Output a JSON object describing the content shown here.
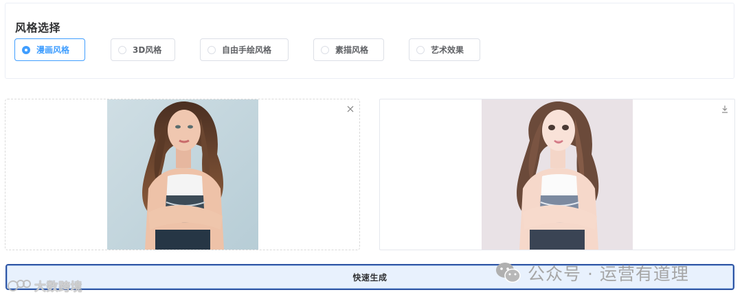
{
  "style_panel": {
    "title": "风格选择",
    "options": [
      {
        "label": "漫画风格",
        "checked": true
      },
      {
        "label": "3D风格",
        "checked": false
      },
      {
        "label": "自由手绘风格",
        "checked": false
      },
      {
        "label": "素描风格",
        "checked": false
      },
      {
        "label": "艺术效果",
        "checked": false
      }
    ]
  },
  "upload_pane": {
    "close_icon": "close-icon"
  },
  "result_pane": {
    "download_icon": "download-icon"
  },
  "generate_button": {
    "label": "快速生成"
  },
  "watermarks": {
    "left": "大数跨境",
    "right": "公众号 · 运营有道理"
  },
  "colors": {
    "accent": "#409eff",
    "button_border": "#2f55a4",
    "button_bg": "#e8f1fd"
  }
}
